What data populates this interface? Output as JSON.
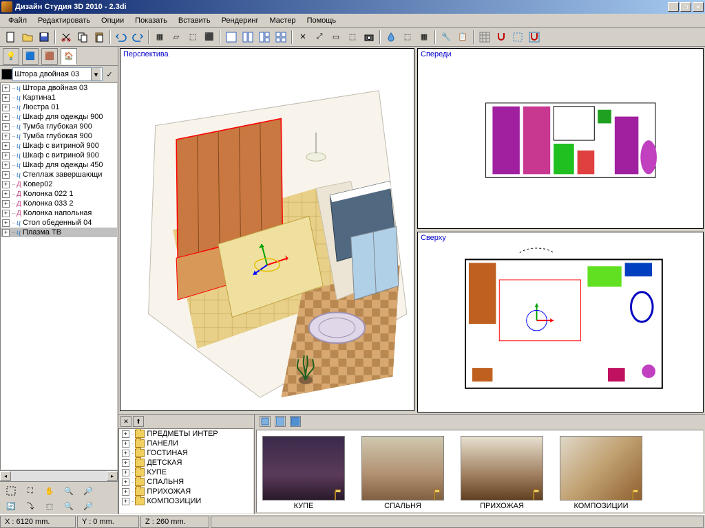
{
  "title": "Дизайн Студия 3D 2010 - 2.3di",
  "menu": [
    "Файл",
    "Редактировать",
    "Опции",
    "Показать",
    "Вставить",
    "Рендеринг",
    "Мастер",
    "Помощь"
  ],
  "dropdown_value": "Штора двойная 03",
  "scene_tree": [
    {
      "label": "Штора двойная 03",
      "type": "obj"
    },
    {
      "label": "Картина1",
      "type": "obj"
    },
    {
      "label": "Люстра 01",
      "type": "obj"
    },
    {
      "label": "Шкаф для одежды 900",
      "type": "obj"
    },
    {
      "label": "Тумба глубокая 900",
      "type": "obj"
    },
    {
      "label": "Тумба глубокая 900",
      "type": "obj"
    },
    {
      "label": "Шкаф с витриной 900",
      "type": "obj"
    },
    {
      "label": "Шкаф с витриной 900",
      "type": "obj"
    },
    {
      "label": "Шкаф для одежды 450",
      "type": "obj"
    },
    {
      "label": "Стеллаж завершающи",
      "type": "obj"
    },
    {
      "label": "Ковер02",
      "type": "acc"
    },
    {
      "label": "Колонка 022 1",
      "type": "acc"
    },
    {
      "label": "Колонка 033 2",
      "type": "acc"
    },
    {
      "label": "Колонка напольная",
      "type": "acc"
    },
    {
      "label": "Стол обеденный 04",
      "type": "obj"
    },
    {
      "label": "Плазма ТВ",
      "type": "obj",
      "selected": true
    }
  ],
  "viewports": {
    "perspective": "Перспектива",
    "front": "Спереди",
    "top": "Сверху"
  },
  "folder_tree": [
    "ПРЕДМЕТЫ ИНТЕР",
    "ПАНЕЛИ",
    "ГОСТИНАЯ",
    "ДЕТСКАЯ",
    "КУПЕ",
    "СПАЛЬНЯ",
    "ПРИХОЖАЯ",
    "КОМПОЗИЦИИ"
  ],
  "thumbs": [
    {
      "label": "КУПЕ",
      "bg": "linear-gradient(180deg,#3a2a4a 0%,#5a3a5a 60%,#2a1a2a 100%)"
    },
    {
      "label": "СПАЛЬНЯ",
      "bg": "linear-gradient(180deg,#d0c8b0 0%,#b09070 60%,#806040 100%)"
    },
    {
      "label": "ПРИХОЖАЯ",
      "bg": "linear-gradient(180deg,#e8e0d0 0%,#a08060 60%,#604020 100%)"
    },
    {
      "label": "КОМПОЗИЦИИ",
      "bg": "linear-gradient(135deg,#e0d8c8 0%,#c0a070 50%,#906030 100%)"
    }
  ],
  "status": {
    "x": "X : 6120 mm.",
    "y": "Y : 0 mm.",
    "z": "Z : 260 mm."
  }
}
